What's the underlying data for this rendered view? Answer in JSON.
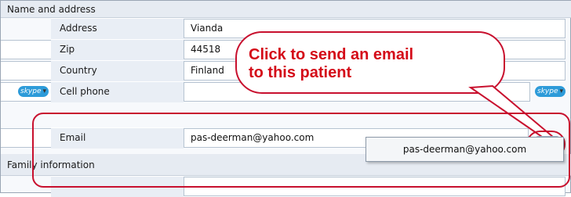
{
  "section_headers": {
    "name_address": "Name and address",
    "family": "Family information"
  },
  "fields": [
    {
      "label": "Address",
      "value": "Vianda"
    },
    {
      "label": "Zip",
      "value": "44518"
    },
    {
      "label": "Country",
      "value": "Finland"
    },
    {
      "label": "Cell phone",
      "value": ""
    },
    {
      "label": "Email",
      "value": "pas-deerman@yahoo.com"
    }
  ],
  "skype": {
    "left_label": "skype",
    "right_label": "skype",
    "caret": "▾"
  },
  "callout": {
    "line1": "Click to send an email",
    "line2": "to this patient"
  },
  "email_button": {
    "icon": "email-send-icon",
    "glyph": "✉",
    "caret": "▾"
  },
  "dropdown": {
    "option": "pas-deerman@yahoo.com"
  },
  "colors": {
    "callout_red": "#c8102e",
    "callout_text": "#d40a18",
    "skype_blue": "#2d9bd9"
  }
}
